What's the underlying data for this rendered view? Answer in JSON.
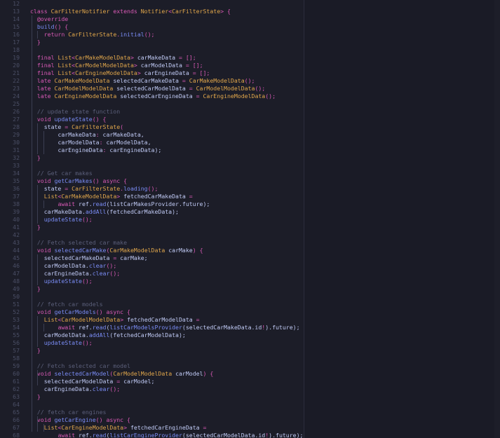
{
  "colors": {
    "keyword": "#d859b5",
    "type": "#e0a64b",
    "function": "#7a8cf5",
    "plain": "#c0caf5",
    "comment": "#5b5f7a",
    "punct": "#d859b5",
    "linenum": "#4b4f66"
  },
  "editor": {
    "line_numbers": [
      "12",
      "13",
      "14",
      "15",
      "16",
      "17",
      "18",
      "19",
      "20",
      "21",
      "22",
      "23",
      "24",
      "25",
      "26",
      "27",
      "28",
      "29",
      "30",
      "31",
      "32",
      "33",
      "34",
      "35",
      "36",
      "37",
      "38",
      "39",
      "40",
      "41",
      "42",
      "43",
      "44",
      "45",
      "46",
      "47",
      "48",
      "49",
      "50",
      "51",
      "52",
      "53",
      "54",
      "55",
      "56",
      "57",
      "58",
      "59",
      "60",
      "61",
      "62",
      "63",
      "64",
      "65",
      "66",
      "67",
      "68"
    ],
    "lines": [
      [],
      [
        [
          "k",
          "class "
        ],
        [
          "t",
          "CarFilterNotifier "
        ],
        [
          "k",
          "extends "
        ],
        [
          "t",
          "Notifier"
        ],
        [
          "p",
          "<"
        ],
        [
          "t",
          "CarFilterState"
        ],
        [
          "p",
          "> {"
        ]
      ],
      [
        [
          "s",
          "  "
        ],
        [
          "k",
          "@override"
        ]
      ],
      [
        [
          "s",
          "  "
        ],
        [
          "f",
          "build"
        ],
        [
          "p",
          "() {"
        ]
      ],
      [
        [
          "s",
          "    "
        ],
        [
          "k",
          "return "
        ],
        [
          "t",
          "CarFilterState"
        ],
        [
          "p",
          "."
        ],
        [
          "f",
          "initial"
        ],
        [
          "p",
          "();"
        ]
      ],
      [
        [
          "s",
          "  "
        ],
        [
          "p",
          "}"
        ]
      ],
      [],
      [
        [
          "s",
          "  "
        ],
        [
          "k",
          "final "
        ],
        [
          "t",
          "List"
        ],
        [
          "p",
          "<"
        ],
        [
          "t",
          "CarMakeModelData"
        ],
        [
          "p",
          "> "
        ],
        [
          "n",
          "carMakeData "
        ],
        [
          "p",
          "= [];"
        ]
      ],
      [
        [
          "s",
          "  "
        ],
        [
          "k",
          "final "
        ],
        [
          "t",
          "List"
        ],
        [
          "p",
          "<"
        ],
        [
          "t",
          "CarModelModelData"
        ],
        [
          "p",
          "> "
        ],
        [
          "n",
          "carModelData "
        ],
        [
          "p",
          "= [];"
        ]
      ],
      [
        [
          "s",
          "  "
        ],
        [
          "k",
          "final "
        ],
        [
          "t",
          "List"
        ],
        [
          "p",
          "<"
        ],
        [
          "t",
          "CarEngineModelData"
        ],
        [
          "p",
          "> "
        ],
        [
          "n",
          "carEngineData "
        ],
        [
          "p",
          "= [];"
        ]
      ],
      [
        [
          "s",
          "  "
        ],
        [
          "k",
          "late "
        ],
        [
          "t",
          "CarMakeModelData "
        ],
        [
          "n",
          "selectedCarMakeData "
        ],
        [
          "p",
          "= "
        ],
        [
          "t",
          "CarMakeModelData"
        ],
        [
          "p",
          "();"
        ]
      ],
      [
        [
          "s",
          "  "
        ],
        [
          "k",
          "late "
        ],
        [
          "t",
          "CarModelModelData "
        ],
        [
          "n",
          "selectedCarModelData "
        ],
        [
          "p",
          "= "
        ],
        [
          "t",
          "CarModelModelData"
        ],
        [
          "p",
          "();"
        ]
      ],
      [
        [
          "s",
          "  "
        ],
        [
          "k",
          "late "
        ],
        [
          "t",
          "CarEngineModelData "
        ],
        [
          "n",
          "selectedCarEngineData "
        ],
        [
          "p",
          "= "
        ],
        [
          "t",
          "CarEngineModelData"
        ],
        [
          "p",
          "();"
        ]
      ],
      [],
      [
        [
          "s",
          "  "
        ],
        [
          "c",
          "// update state function"
        ]
      ],
      [
        [
          "s",
          "  "
        ],
        [
          "k",
          "void "
        ],
        [
          "f",
          "updateState"
        ],
        [
          "p",
          "() {"
        ]
      ],
      [
        [
          "s",
          "    "
        ],
        [
          "n",
          "state "
        ],
        [
          "p",
          "= "
        ],
        [
          "t",
          "CarFilterState"
        ],
        [
          "p",
          "("
        ]
      ],
      [
        [
          "s",
          "        "
        ],
        [
          "n",
          "carMakeData"
        ],
        [
          "p",
          ": "
        ],
        [
          "n",
          "carMakeData,"
        ]
      ],
      [
        [
          "s",
          "        "
        ],
        [
          "n",
          "carModelData"
        ],
        [
          "p",
          ": "
        ],
        [
          "n",
          "carModelData,"
        ]
      ],
      [
        [
          "s",
          "        "
        ],
        [
          "n",
          "carEngineData"
        ],
        [
          "p",
          ": "
        ],
        [
          "n",
          "carEngineData);"
        ]
      ],
      [
        [
          "s",
          "  "
        ],
        [
          "p",
          "}"
        ]
      ],
      [],
      [
        [
          "s",
          "  "
        ],
        [
          "c",
          "// Get car makes"
        ]
      ],
      [
        [
          "s",
          "  "
        ],
        [
          "k",
          "void "
        ],
        [
          "f",
          "getCarMakes"
        ],
        [
          "p",
          "() "
        ],
        [
          "k",
          "async "
        ],
        [
          "p",
          "{"
        ]
      ],
      [
        [
          "s",
          "    "
        ],
        [
          "n",
          "state "
        ],
        [
          "p",
          "= "
        ],
        [
          "t",
          "CarFilterState"
        ],
        [
          "p",
          "."
        ],
        [
          "f",
          "loading"
        ],
        [
          "p",
          "();"
        ]
      ],
      [
        [
          "s",
          "    "
        ],
        [
          "t",
          "List"
        ],
        [
          "p",
          "<"
        ],
        [
          "t",
          "CarMakeModelData"
        ],
        [
          "p",
          "> "
        ],
        [
          "n",
          "fetchedCarMakeData "
        ],
        [
          "p",
          "="
        ]
      ],
      [
        [
          "s",
          "        "
        ],
        [
          "k",
          "await "
        ],
        [
          "n",
          "ref."
        ],
        [
          "f",
          "read"
        ],
        [
          "n",
          "(listCarMakesProvider.future);"
        ]
      ],
      [
        [
          "s",
          "    "
        ],
        [
          "n",
          "carMakeData."
        ],
        [
          "f",
          "addAll"
        ],
        [
          "n",
          "(fetchedCarMakeData);"
        ]
      ],
      [
        [
          "s",
          "    "
        ],
        [
          "f",
          "updateState"
        ],
        [
          "p",
          "();"
        ]
      ],
      [
        [
          "s",
          "  "
        ],
        [
          "p",
          "}"
        ]
      ],
      [],
      [
        [
          "s",
          "  "
        ],
        [
          "c",
          "// Fetch selected car make"
        ]
      ],
      [
        [
          "s",
          "  "
        ],
        [
          "k",
          "void "
        ],
        [
          "f",
          "selectedCarMake"
        ],
        [
          "p",
          "("
        ],
        [
          "t",
          "CarMakeModelData "
        ],
        [
          "n",
          "carMake"
        ],
        [
          "p",
          ") {"
        ]
      ],
      [
        [
          "s",
          "    "
        ],
        [
          "n",
          "selectedCarMakeData "
        ],
        [
          "p",
          "= "
        ],
        [
          "n",
          "carMake;"
        ]
      ],
      [
        [
          "s",
          "    "
        ],
        [
          "n",
          "carModelData."
        ],
        [
          "f",
          "clear"
        ],
        [
          "p",
          "();"
        ]
      ],
      [
        [
          "s",
          "    "
        ],
        [
          "n",
          "carEngineData."
        ],
        [
          "f",
          "clear"
        ],
        [
          "p",
          "();"
        ]
      ],
      [
        [
          "s",
          "    "
        ],
        [
          "f",
          "updateState"
        ],
        [
          "p",
          "();"
        ]
      ],
      [
        [
          "s",
          "  "
        ],
        [
          "p",
          "}"
        ]
      ],
      [],
      [
        [
          "s",
          "  "
        ],
        [
          "c",
          "// fetch car models"
        ]
      ],
      [
        [
          "s",
          "  "
        ],
        [
          "k",
          "void "
        ],
        [
          "f",
          "getCarModels"
        ],
        [
          "p",
          "() "
        ],
        [
          "k",
          "async "
        ],
        [
          "p",
          "{"
        ]
      ],
      [
        [
          "s",
          "    "
        ],
        [
          "t",
          "List"
        ],
        [
          "p",
          "<"
        ],
        [
          "t",
          "CarModelModelData"
        ],
        [
          "p",
          "> "
        ],
        [
          "n",
          "fetchedCarModelData "
        ],
        [
          "p",
          "="
        ]
      ],
      [
        [
          "s",
          "        "
        ],
        [
          "k",
          "await "
        ],
        [
          "n",
          "ref."
        ],
        [
          "f",
          "read"
        ],
        [
          "n",
          "("
        ],
        [
          "f",
          "listCarModelsProvider"
        ],
        [
          "n",
          "(selectedCarMakeData.id"
        ],
        [
          "p",
          "!"
        ],
        [
          "n",
          ").future);"
        ]
      ],
      [
        [
          "s",
          "    "
        ],
        [
          "n",
          "carModelData."
        ],
        [
          "f",
          "addAll"
        ],
        [
          "n",
          "(fetchedCarModelData);"
        ]
      ],
      [
        [
          "s",
          "    "
        ],
        [
          "f",
          "updateState"
        ],
        [
          "p",
          "();"
        ]
      ],
      [
        [
          "s",
          "  "
        ],
        [
          "p",
          "}"
        ]
      ],
      [],
      [
        [
          "s",
          "  "
        ],
        [
          "c",
          "// Fetch selected car model"
        ]
      ],
      [
        [
          "s",
          "  "
        ],
        [
          "k",
          "void "
        ],
        [
          "f",
          "selectedCarModel"
        ],
        [
          "p",
          "("
        ],
        [
          "t",
          "CarModelModelData "
        ],
        [
          "n",
          "carModel"
        ],
        [
          "p",
          ") {"
        ]
      ],
      [
        [
          "s",
          "    "
        ],
        [
          "n",
          "selectedCarModelData "
        ],
        [
          "p",
          "= "
        ],
        [
          "n",
          "carModel;"
        ]
      ],
      [
        [
          "s",
          "    "
        ],
        [
          "n",
          "carEngineData."
        ],
        [
          "f",
          "clear"
        ],
        [
          "p",
          "();"
        ]
      ],
      [
        [
          "s",
          "  "
        ],
        [
          "p",
          "}"
        ]
      ],
      [],
      [
        [
          "s",
          "  "
        ],
        [
          "c",
          "// fetch car engines"
        ]
      ],
      [
        [
          "s",
          "  "
        ],
        [
          "k",
          "void "
        ],
        [
          "f",
          "getCarEngine"
        ],
        [
          "p",
          "() "
        ],
        [
          "k",
          "async "
        ],
        [
          "p",
          "{"
        ]
      ],
      [
        [
          "s",
          "    "
        ],
        [
          "t",
          "List"
        ],
        [
          "p",
          "<"
        ],
        [
          "t",
          "CarEngineModelData"
        ],
        [
          "p",
          "> "
        ],
        [
          "n",
          "fetchedCarEngineData "
        ],
        [
          "p",
          "="
        ]
      ],
      [
        [
          "s",
          "        "
        ],
        [
          "k",
          "await "
        ],
        [
          "n",
          "ref."
        ],
        [
          "f",
          "read"
        ],
        [
          "n",
          "("
        ],
        [
          "f",
          "listCarEngineProvider"
        ],
        [
          "n",
          "(selectedCarModelData.id"
        ],
        [
          "p",
          "!"
        ],
        [
          "n",
          ").future);"
        ]
      ]
    ]
  }
}
